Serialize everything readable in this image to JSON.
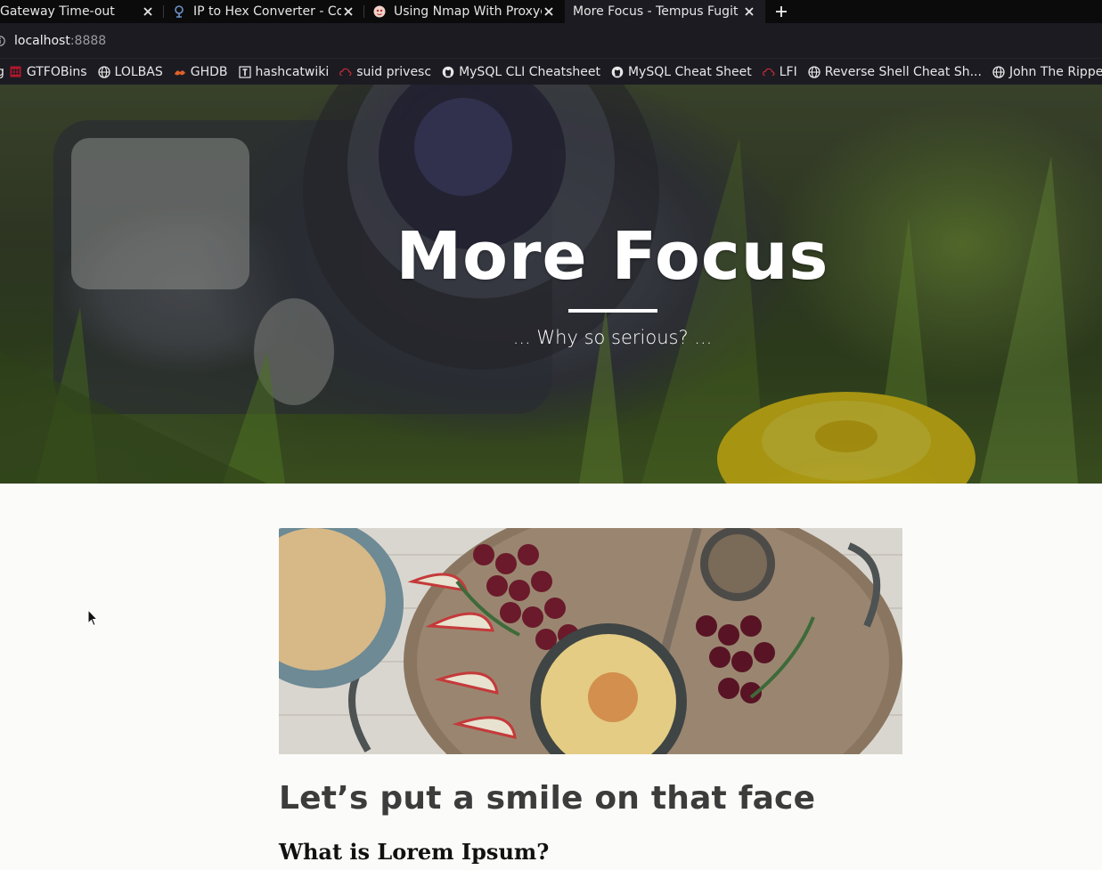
{
  "browser": {
    "tabs": [
      {
        "title": "Gateway Time-out",
        "favicon": "none",
        "active": false
      },
      {
        "title": "IP to Hex Converter - Co",
        "favicon": "converter-icon",
        "active": false
      },
      {
        "title": "Using Nmap With Proxyc",
        "favicon": "medium-icon",
        "active": false
      },
      {
        "title": "More Focus - Tempus Fugit",
        "favicon": "none",
        "active": true
      }
    ],
    "url": {
      "host": "localhost",
      "port": ":8888"
    },
    "bookmarks": [
      {
        "label": "g",
        "icon": "none"
      },
      {
        "label": "GTFOBins",
        "icon": "gtfobins-icon"
      },
      {
        "label": "LOLBAS",
        "icon": "globe-icon"
      },
      {
        "label": "GHDB",
        "icon": "exploitdb-icon"
      },
      {
        "label": "hashcatwiki",
        "icon": "wiki-icon"
      },
      {
        "label": "suid privesc",
        "icon": "cloud-icon"
      },
      {
        "label": "MySQL CLI Cheatsheet",
        "icon": "github-icon"
      },
      {
        "label": "MySQL Cheat Sheet",
        "icon": "github-icon"
      },
      {
        "label": "LFI",
        "icon": "cloud-icon"
      },
      {
        "label": "Reverse Shell Cheat Sh...",
        "icon": "globe-icon"
      },
      {
        "label": "John The Ripper H",
        "icon": "globe-icon"
      }
    ]
  },
  "hero": {
    "title": "More Focus",
    "subtitle": "... Why so serious? ..."
  },
  "post": {
    "heading": "Let’s put a smile on that face",
    "subheading": "What is Lorem Ipsum?"
  },
  "colors": {
    "chrome_bg": "#1c1b22",
    "tabstrip_bg": "#0b0b0c",
    "page_bg": "#fbfbf9",
    "heading_text": "#3c3c3c"
  }
}
